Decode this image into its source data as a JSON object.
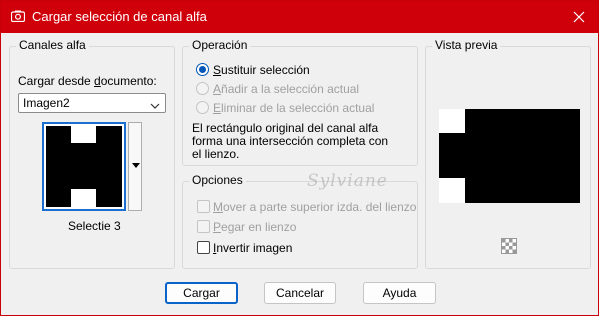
{
  "window": {
    "title": "Cargar selección de canal alfa",
    "title_bar_color": "#d0000b",
    "accent_color": "#0a63c9"
  },
  "alpha_channels": {
    "group_label": "Canales alfa",
    "load_from_label": "Cargar desde documento:",
    "document_value": "Imagen2",
    "selection_name": "Selectie 3"
  },
  "operation": {
    "group_label": "Operación",
    "options": [
      {
        "label": "Sustituir selección",
        "selected": true,
        "enabled": true
      },
      {
        "label": "Añadir a la selección actual",
        "selected": false,
        "enabled": false
      },
      {
        "label": "Eliminar de la selección actual",
        "selected": false,
        "enabled": false
      }
    ],
    "description": [
      "El rectángulo original del canal alfa",
      "forma una intersección completa con",
      "el lienzo."
    ]
  },
  "options": {
    "group_label": "Opciones",
    "items": [
      {
        "label": "Mover a parte superior izda. del lienzo",
        "checked": false,
        "enabled": false
      },
      {
        "label": "Pegar en lienzo",
        "checked": false,
        "enabled": false
      },
      {
        "label": "Invertir imagen",
        "checked": false,
        "enabled": true
      }
    ]
  },
  "preview": {
    "group_label": "Vista previa"
  },
  "watermark": "Sylviane",
  "buttons": {
    "load": "Cargar",
    "cancel": "Cancelar",
    "help": "Ayuda"
  }
}
